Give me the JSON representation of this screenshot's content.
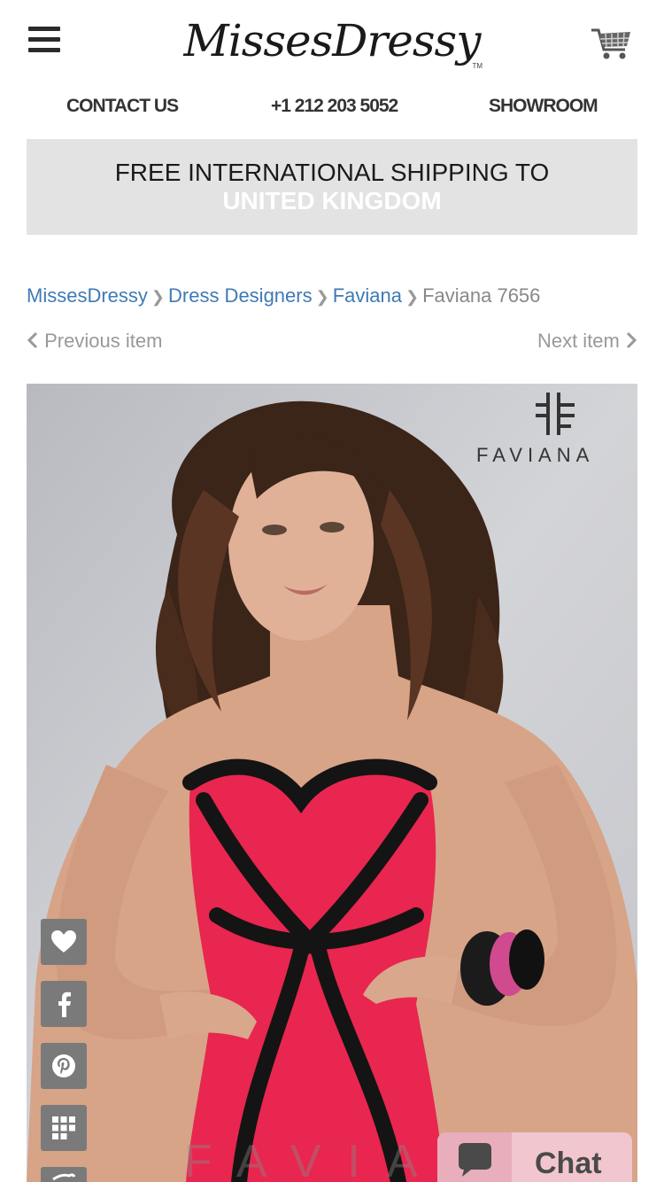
{
  "header": {
    "logo_text": "MissesDressy",
    "logo_tm": "TM"
  },
  "topnav": {
    "contact": "CONTACT US",
    "phone": "+1 212 203 5052",
    "showroom": "SHOWROOM"
  },
  "banner": {
    "line1": "FREE INTERNATIONAL SHIPPING TO",
    "line2": "UNITED KINGDOM"
  },
  "breadcrumb": [
    {
      "label": "MissesDressy",
      "link": true
    },
    {
      "label": "Dress Designers",
      "link": true
    },
    {
      "label": "Faviana",
      "link": true
    },
    {
      "label": "Faviana 7656",
      "link": false
    }
  ],
  "pager": {
    "prev": "Previous item",
    "next": "Next item"
  },
  "product_image": {
    "brand_text": "FAVIANA",
    "watermark_text": "FAVIANA"
  },
  "social_buttons": [
    "heart-icon",
    "facebook-icon",
    "pinterest-icon",
    "grid-icon",
    "twitter-icon"
  ],
  "chat": {
    "label": "Chat"
  },
  "colors": {
    "link": "#3f7ab5",
    "banner_bg": "#e3e3e3",
    "dress": "#e8264f",
    "chat_bg": "#f2c6cf"
  }
}
